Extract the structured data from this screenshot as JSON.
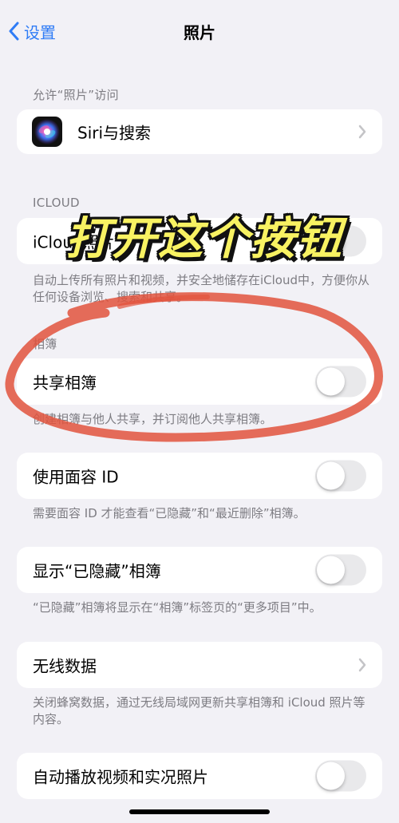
{
  "nav": {
    "back_label": "设置",
    "title": "照片"
  },
  "sections": {
    "allow_access": {
      "header": "允许“照片”访问",
      "siri_label": "Siri与搜索"
    },
    "icloud": {
      "header": "ICLOUD",
      "label": "iCloud照片",
      "footer": "自动上传所有照片和视频，并安全地储存在iCloud中，方便你从任何设备浏览、搜索和共享。",
      "toggle_on": false
    },
    "albums": {
      "header": "相簿",
      "shared_label": "共享相簿",
      "shared_footer": "创建相簿与他人共享，并订阅他人共享相簿。",
      "shared_on": false
    },
    "face_id": {
      "label": "使用面容 ID",
      "footer": "需要面容 ID 才能查看“已隐藏”和“最近删除”相簿。",
      "toggle_on": false
    },
    "hidden": {
      "label": "显示“已隐藏”相簿",
      "footer": "“已隐藏”相簿将显示在“相簿”标签页的“更多项目”中。",
      "toggle_on": false
    },
    "wireless": {
      "label": "无线数据",
      "footer": "关闭蜂窝数据，通过无线局域网更新共享相簿和 iCloud 照片等内容。"
    },
    "autoplay": {
      "label": "自动播放视频和实况照片",
      "toggle_on": false
    }
  },
  "annotation": {
    "text": "打开这个按钮",
    "text_color": "#f8f262",
    "circle_color": "#e2533d"
  },
  "colors": {
    "accent": "#2f7cf6",
    "background": "#f2f1f6",
    "secondary_text": "#7d7c82"
  }
}
